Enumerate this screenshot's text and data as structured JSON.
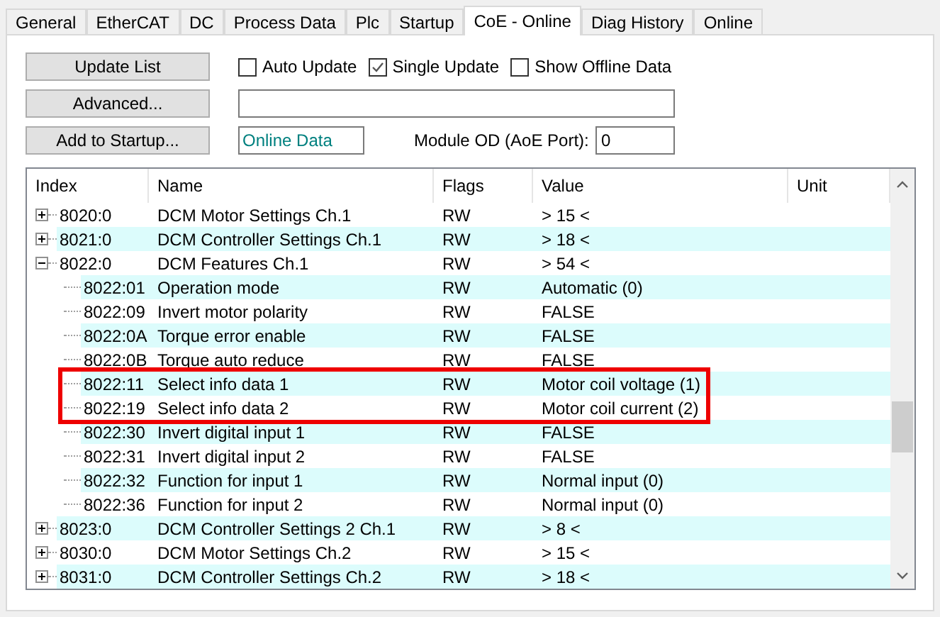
{
  "tabs": [
    {
      "label": "General",
      "selected": false
    },
    {
      "label": "EtherCAT",
      "selected": false
    },
    {
      "label": "DC",
      "selected": false
    },
    {
      "label": "Process Data",
      "selected": false
    },
    {
      "label": "Plc",
      "selected": false
    },
    {
      "label": "Startup",
      "selected": false
    },
    {
      "label": "CoE - Online",
      "selected": true
    },
    {
      "label": "Diag History",
      "selected": false
    },
    {
      "label": "Online",
      "selected": false
    }
  ],
  "buttons": [
    "Update List",
    "Advanced...",
    "Add to Startup..."
  ],
  "checkboxes": [
    {
      "label": "Auto Update",
      "checked": false
    },
    {
      "label": "Single Update",
      "checked": true
    },
    {
      "label": "Show Offline Data",
      "checked": false
    }
  ],
  "status_field": {
    "value": "Online Data"
  },
  "module_od": {
    "label": "Module OD (AoE Port):",
    "value": "0"
  },
  "table": {
    "columns": [
      "Index",
      "Name",
      "Flags",
      "Value",
      "Unit"
    ],
    "rows": [
      {
        "index": "8020:0",
        "name": "DCM Motor Settings Ch.1",
        "flags": "RW",
        "value": "> 15 <",
        "expanded": false,
        "highlighted": false
      },
      {
        "index": "8021:0",
        "name": "DCM Controller Settings Ch.1",
        "flags": "RW",
        "value": "> 18 <",
        "expanded": false,
        "highlighted": false
      },
      {
        "index": "8022:0",
        "name": "DCM Features Ch.1",
        "flags": "RW",
        "value": "> 54 <",
        "expanded": true,
        "highlighted": false,
        "children": [
          {
            "index": "8022:01",
            "name": "Operation mode",
            "flags": "RW",
            "value": "Automatic (0)",
            "highlighted": false
          },
          {
            "index": "8022:09",
            "name": "Invert motor polarity",
            "flags": "RW",
            "value": "FALSE",
            "highlighted": false
          },
          {
            "index": "8022:0A",
            "name": "Torque error enable",
            "flags": "RW",
            "value": "FALSE",
            "highlighted": false
          },
          {
            "index": "8022:0B",
            "name": "Torque auto reduce",
            "flags": "RW",
            "value": "FALSE",
            "highlighted": false
          },
          {
            "index": "8022:11",
            "name": "Select info data 1",
            "flags": "RW",
            "value": "Motor coil voltage (1)",
            "highlighted": true
          },
          {
            "index": "8022:19",
            "name": "Select info data 2",
            "flags": "RW",
            "value": "Motor coil current (2)",
            "highlighted": true
          },
          {
            "index": "8022:30",
            "name": "Invert digital input 1",
            "flags": "RW",
            "value": "FALSE",
            "highlighted": false
          },
          {
            "index": "8022:31",
            "name": "Invert digital input 2",
            "flags": "RW",
            "value": "FALSE",
            "highlighted": false
          },
          {
            "index": "8022:32",
            "name": "Function for input 1",
            "flags": "RW",
            "value": "Normal input (0)",
            "highlighted": false
          },
          {
            "index": "8022:36",
            "name": "Function for input 2",
            "flags": "RW",
            "value": "Normal input (0)",
            "highlighted": false
          }
        ]
      },
      {
        "index": "8023:0",
        "name": "DCM Controller Settings 2 Ch.1",
        "flags": "RW",
        "value": "> 8 <",
        "expanded": false,
        "highlighted": false
      },
      {
        "index": "8030:0",
        "name": "DCM Motor Settings Ch.2",
        "flags": "RW",
        "value": "> 15 <",
        "expanded": false,
        "highlighted": false
      },
      {
        "index": "8031:0",
        "name": "DCM Controller Settings Ch.2",
        "flags": "RW",
        "value": "> 18 <",
        "expanded": false,
        "highlighted": false
      }
    ]
  }
}
